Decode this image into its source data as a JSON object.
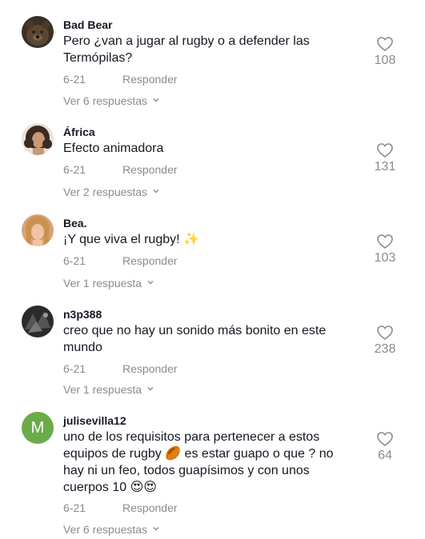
{
  "comments": [
    {
      "username": "Bad Bear",
      "text": "Pero ¿van a jugar al rugby o a defender las Termópilas?",
      "date": "6-21",
      "reply_label": "Responder",
      "replies_label": "Ver 6 respuestas",
      "likes": "108",
      "avatar_icon": "bear-avatar"
    },
    {
      "username": "África",
      "text": "Efecto animadora",
      "date": "6-21",
      "reply_label": "Responder",
      "replies_label": "Ver 2 respuestas",
      "likes": "131",
      "avatar_icon": "woman-curly-hair-avatar"
    },
    {
      "username": "Bea.",
      "text": "¡Y que viva el rugby! ✨",
      "date": "6-21",
      "reply_label": "Responder",
      "replies_label": "Ver 1 respuesta",
      "likes": "103",
      "avatar_icon": "woman-blonde-avatar"
    },
    {
      "username": "n3p388",
      "text": "creo que no hay un sonido más bonito en este mundo",
      "date": "6-21",
      "reply_label": "Responder",
      "replies_label": "Ver 1 respuesta",
      "likes": "238",
      "avatar_icon": "dark-photo-avatar"
    },
    {
      "username": "julisevilla12",
      "text": "uno de los requisitos para pertenecer a estos equipos de rugby 🏉 es estar guapo o que ? no hay ni un feo, todos guapísimos y con unos cuerpos 10 😍😍",
      "date": "6-21",
      "reply_label": "Responder",
      "replies_label": "Ver 6 respuestas",
      "likes": "64",
      "avatar_letter": "M",
      "avatar_color": "#6aab4a"
    }
  ]
}
